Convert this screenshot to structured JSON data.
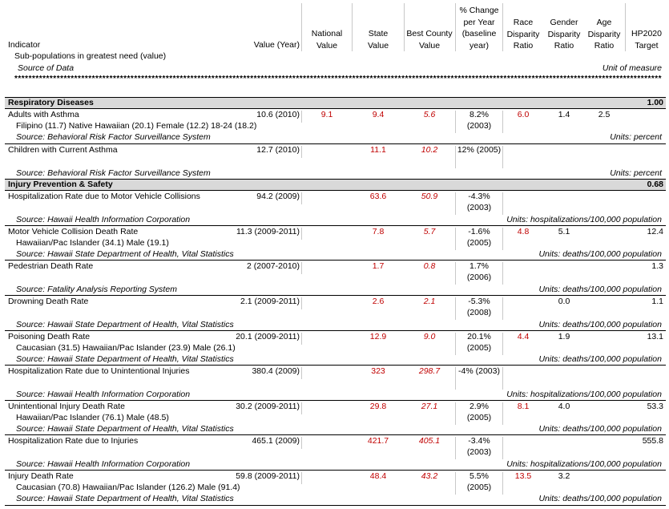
{
  "header": {
    "indicator": "Indicator",
    "subpop": "Sub-populations in greatest need (value)",
    "source": "Source of Data",
    "unit": "Unit of measure",
    "value_year": "Value (Year)",
    "national": [
      "National",
      "Value"
    ],
    "state": [
      "State",
      "Value"
    ],
    "best_county": [
      "Best County",
      "Value"
    ],
    "pct_change": [
      "% Change",
      "per Year",
      "(baseline",
      "year)"
    ],
    "race": [
      "Race",
      "Disparity",
      "Ratio"
    ],
    "gender": [
      "Gender",
      "Disparity",
      "Ratio"
    ],
    "age": [
      "Age",
      "Disparity",
      "Ratio"
    ],
    "hp2020": [
      "HP2020",
      "Target"
    ],
    "stars": "**********************************************************************************************************************************************************************************************"
  },
  "sections": {
    "respiratory": {
      "name": "Respiratory Diseases",
      "score": "1.00"
    },
    "injury": {
      "name": "Injury Prevention & Safety",
      "score": "0.68"
    }
  },
  "rows": [
    {
      "name": "Adults with Asthma",
      "value": "10.6 (2010)",
      "national": "9.1",
      "state": "9.4",
      "county": "5.6",
      "change": "8.2%",
      "change_year": "(2003)",
      "race": "6.0",
      "gender": "1.4",
      "age": "2.5",
      "hp2020": "",
      "subpop": "Filipino (11.7) Native Hawaiian (20.1) Female (12.2) 18-24 (18.2)",
      "source": "Source: Behavioral Risk Factor Surveillance System",
      "unit": "Units: percent"
    },
    {
      "name": "Children with Current Asthma",
      "value": "12.7 (2010)",
      "national": "",
      "state": "11.1",
      "county": "10.2",
      "change": "12% (2005)",
      "change_year": "",
      "race": "",
      "gender": "",
      "age": "",
      "hp2020": "",
      "subpop": "",
      "source": "Source: Behavioral Risk Factor Surveillance System",
      "unit": "Units: percent"
    },
    {
      "name": "Hospitalization Rate due to Motor Vehicle Collisions",
      "value": "94.2 (2009)",
      "national": "",
      "state": "63.6",
      "county": "50.9",
      "change": "-4.3%",
      "change_year": "(2003)",
      "race": "",
      "gender": "",
      "age": "",
      "hp2020": "",
      "subpop": "",
      "source": "Source: Hawaii Health Information Corporation",
      "unit": "Units: hospitalizations/100,000 population"
    },
    {
      "name": "Motor Vehicle Collision Death Rate",
      "value": "11.3 (2009-2011)",
      "national": "",
      "state": "7.8",
      "county": "5.7",
      "change": "-1.6%",
      "change_year": "(2005)",
      "race": "4.8",
      "gender": "5.1",
      "age": "",
      "hp2020": "12.4",
      "subpop": "Hawaiian/Pac Islander (34.1) Male (19.1)",
      "source": "Source: Hawaii State Department of Health, Vital Statistics",
      "unit": "Units: deaths/100,000 population"
    },
    {
      "name": "Pedestrian Death Rate",
      "value": "2 (2007-2010)",
      "national": "",
      "state": "1.7",
      "county": "0.8",
      "change": "1.7%",
      "change_year": "(2006)",
      "race": "",
      "gender": "",
      "age": "",
      "hp2020": "1.3",
      "subpop": "",
      "source": "Source: Fatality Analysis Reporting System",
      "unit": "Units: deaths/100,000 population"
    },
    {
      "name": "Drowning Death Rate",
      "value": "2.1 (2009-2011)",
      "national": "",
      "state": "2.6",
      "county": "2.1",
      "change": "-5.3%",
      "change_year": "(2008)",
      "race": "",
      "gender": "0.0",
      "age": "",
      "hp2020": "1.1",
      "subpop": "",
      "source": "Source: Hawaii State Department of Health, Vital Statistics",
      "unit": "Units: deaths/100,000 population"
    },
    {
      "name": "Poisoning Death Rate",
      "value": "20.1 (2009-2011)",
      "national": "",
      "state": "12.9",
      "county": "9.0",
      "change": "20.1%",
      "change_year": "(2005)",
      "race": "4.4",
      "gender": "1.9",
      "age": "",
      "hp2020": "13.1",
      "subpop": "Caucasian (31.5) Hawaiian/Pac Islander (23.9) Male (26.1)",
      "source": "Source: Hawaii State Department of Health, Vital Statistics",
      "unit": "Units: deaths/100,000 population"
    },
    {
      "name": "Hospitalization Rate due to Unintentional Injuries",
      "value": "380.4 (2009)",
      "national": "",
      "state": "323",
      "county": "298.7",
      "change": "-4% (2003)",
      "change_year": "",
      "race": "",
      "gender": "",
      "age": "",
      "hp2020": "",
      "subpop": "",
      "source": "Source: Hawaii Health Information Corporation",
      "unit": "Units: hospitalizations/100,000 population"
    },
    {
      "name": "Unintentional Injury Death Rate",
      "value": "30.2 (2009-2011)",
      "national": "",
      "state": "29.8",
      "county": "27.1",
      "change": "2.9%",
      "change_year": "(2005)",
      "race": "8.1",
      "gender": "4.0",
      "age": "",
      "hp2020": "53.3",
      "subpop": "Hawaiian/Pac Islander (76.1) Male (48.5)",
      "source": "Source: Hawaii State Department of Health, Vital Statistics",
      "unit": "Units: deaths/100,000 population"
    },
    {
      "name": "Hospitalization Rate due to Injuries",
      "value": "465.1 (2009)",
      "national": "",
      "state": "421.7",
      "county": "405.1",
      "change": "-3.4%",
      "change_year": "(2003)",
      "race": "",
      "gender": "",
      "age": "",
      "hp2020": "555.8",
      "subpop": "",
      "source": "Source: Hawaii Health Information Corporation",
      "unit": "Units: hospitalizations/100,000 population"
    },
    {
      "name": "Injury Death Rate",
      "value": "59.8 (2009-2011)",
      "national": "",
      "state": "48.4",
      "county": "43.2",
      "change": "5.5%",
      "change_year": "(2005)",
      "race": "13.5",
      "gender": "3.2",
      "age": "",
      "hp2020": "",
      "subpop": "Caucasian (70.8) Hawaiian/Pac Islander (126.2) Male (91.4)",
      "source": "Source: Hawaii State Department of Health, Vital Statistics",
      "unit": "Units: deaths/100,000 population"
    }
  ],
  "colors": {
    "red": "#c00000",
    "section_bg": "#d9d9d9"
  }
}
